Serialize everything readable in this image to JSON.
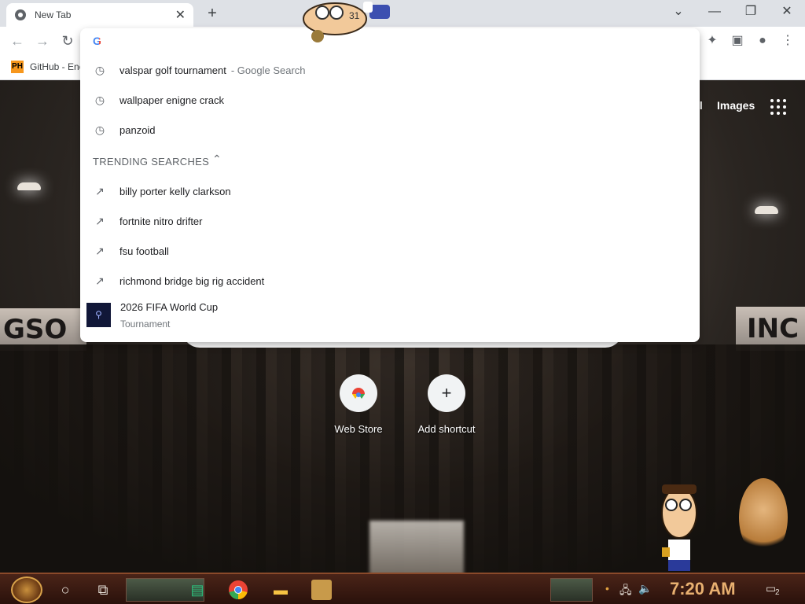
{
  "browser": {
    "tab_title": "New Tab",
    "tab_close": "✕",
    "new_tab": "+",
    "window_controls": {
      "dropdown": "⌄",
      "minimize": "—",
      "restore": "❐",
      "close": "✕"
    },
    "nav": {
      "back": "←",
      "forward": "→",
      "reload": "↻"
    },
    "toolbar_right": {
      "extensions": "✦",
      "sidepanel": "▣",
      "profile": "●",
      "menu": "⋮"
    }
  },
  "bookmarks": [
    {
      "icon_text": "PH",
      "label": "GitHub - Enc"
    }
  ],
  "google_header": {
    "gmail_partial": "il",
    "images": "Images"
  },
  "omnibox": {
    "history": [
      {
        "text": "valspar golf tournament",
        "suffix": "- Google Search"
      },
      {
        "text": "wallpaper enigne crack",
        "suffix": ""
      },
      {
        "text": "panzoid",
        "suffix": ""
      }
    ],
    "trending_header": "TRENDING SEARCHES",
    "trending": [
      "billy porter kelly clarkson",
      "fortnite nitro drifter",
      "fsu football",
      "richmond bridge big rig accident"
    ],
    "entity": {
      "title": "2026 FIFA World Cup",
      "subtitle": "Tournament"
    }
  },
  "shortcuts": [
    {
      "label": "Web Store",
      "icon": "chrome-webstore-icon"
    },
    {
      "label": "Add shortcut",
      "icon": "plus-icon",
      "glyph": "+"
    }
  ],
  "background_signs": {
    "left": "GSO",
    "right": "INC"
  },
  "sticker_text": {
    "hank_top_label": "31"
  },
  "taskbar": {
    "clock": "7:20 AM",
    "notification_count": "2"
  }
}
